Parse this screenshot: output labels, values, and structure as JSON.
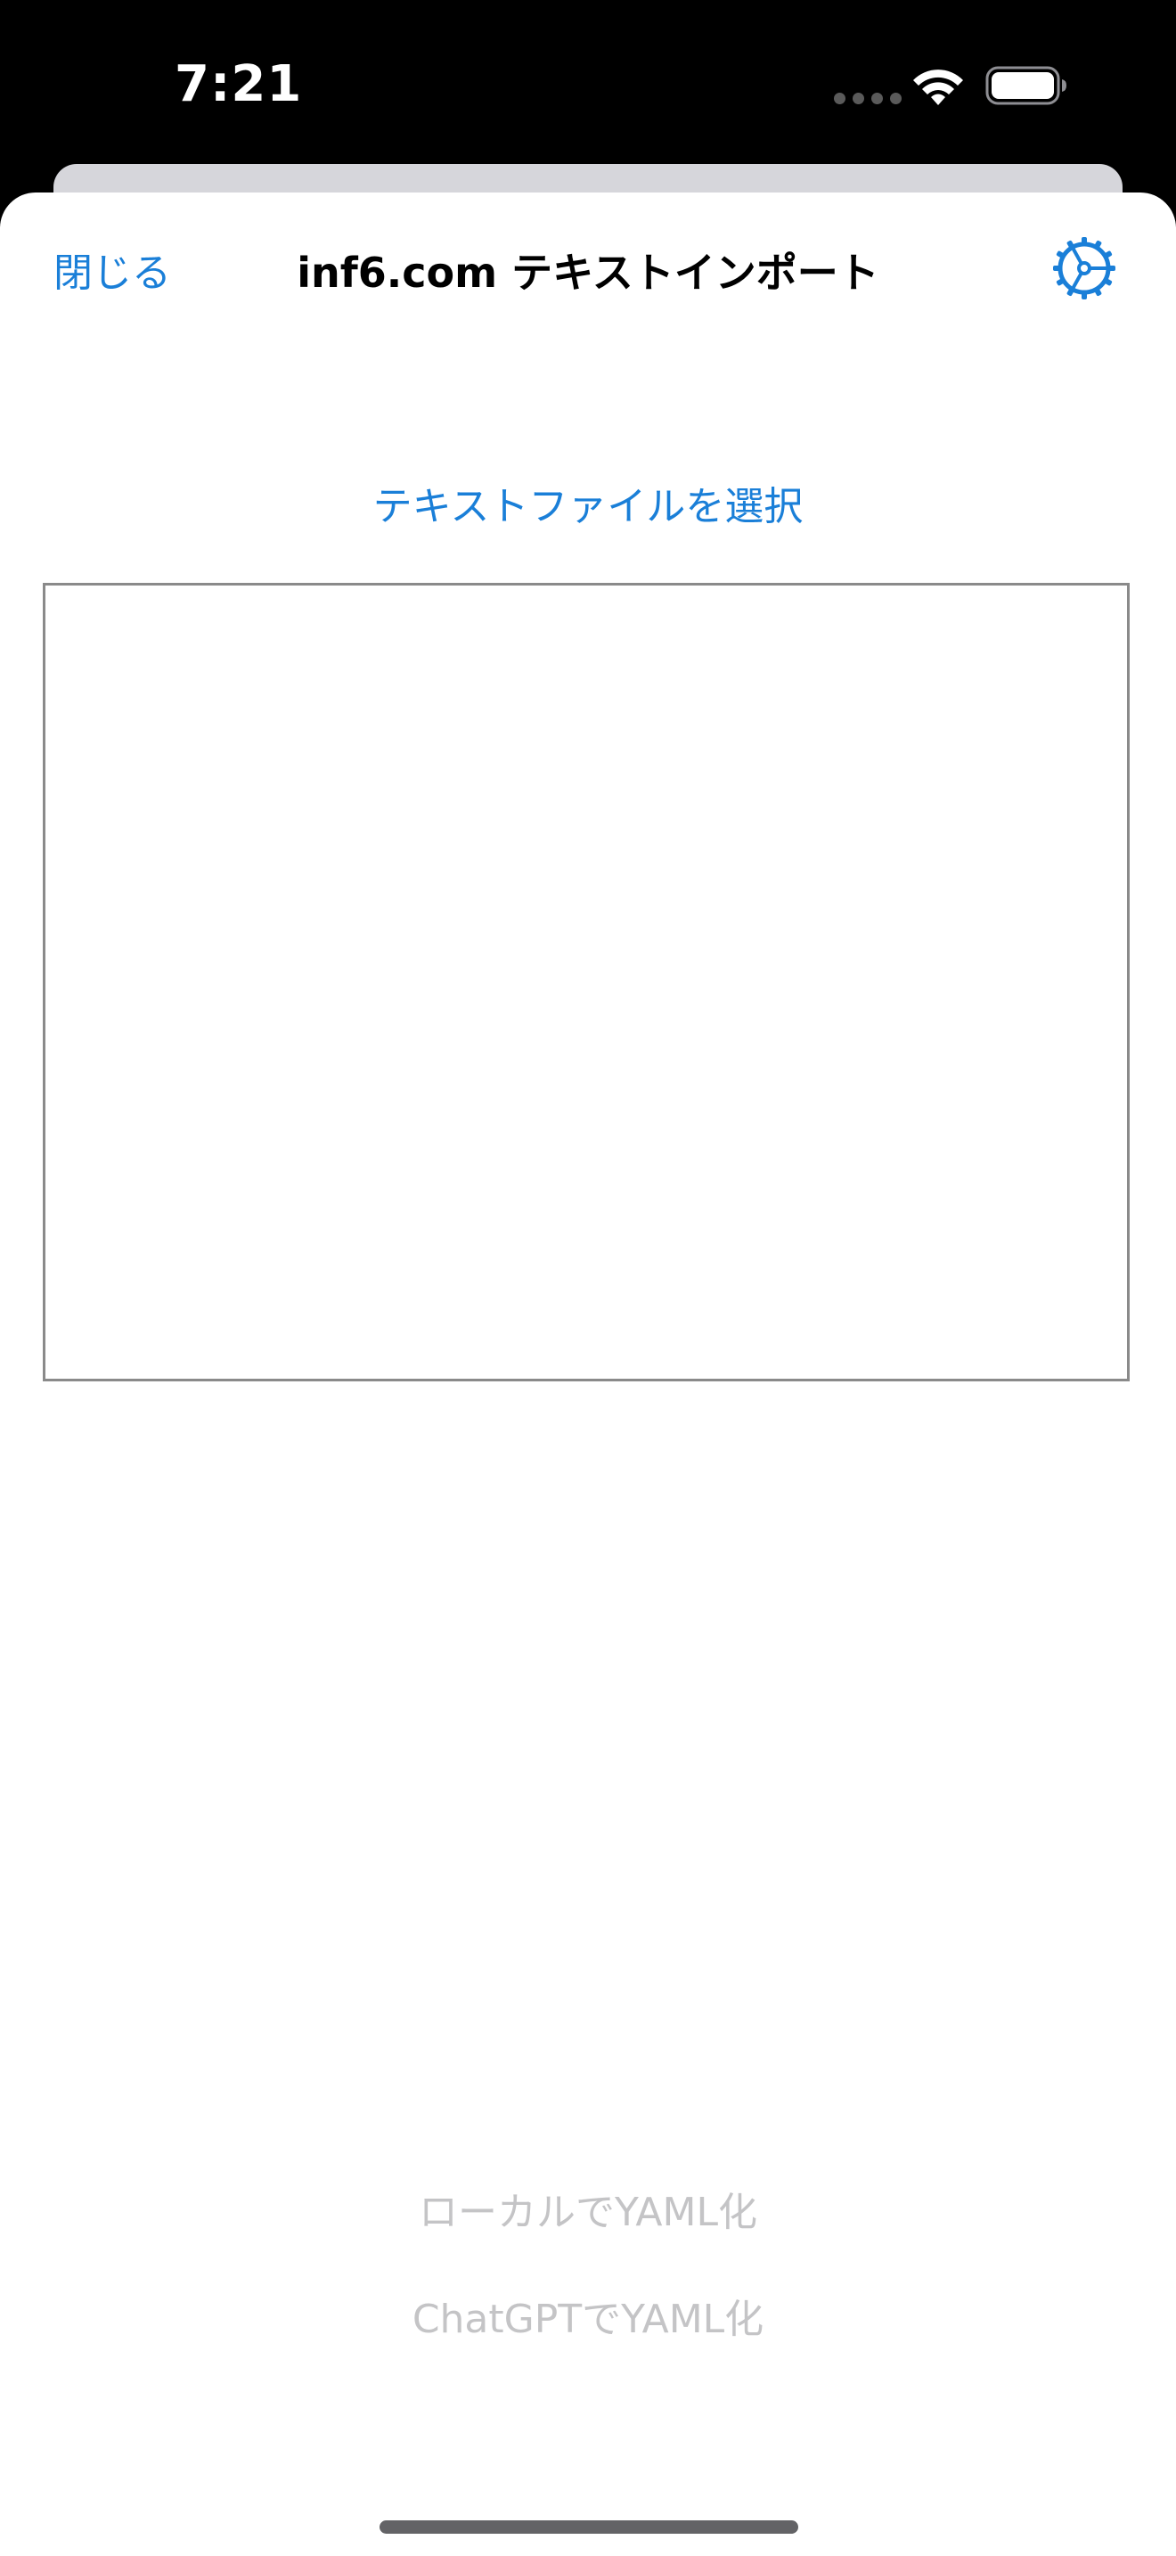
{
  "status_bar": {
    "time": "7:21",
    "wifi_icon": "wifi-icon",
    "battery_icon": "battery-icon",
    "signal_icon": "signal-dots-icon"
  },
  "nav": {
    "close_label": "閉じる",
    "title": "inf6.com テキストインポート",
    "settings_icon": "gear-icon"
  },
  "main": {
    "select_file_label": "テキストファイルを選択",
    "text_value": ""
  },
  "actions": {
    "local_yaml_label": "ローカルでYAML化",
    "chatgpt_yaml_label": "ChatGPTでYAML化"
  },
  "colors": {
    "accent": "#1a7fd8",
    "disabled": "#c4c4c6",
    "border": "#8a8a8a"
  }
}
